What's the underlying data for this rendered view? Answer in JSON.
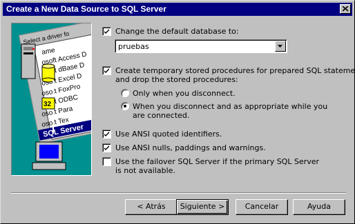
{
  "window": {
    "title": "Create a New Data Source to SQL Server"
  },
  "illustration": {
    "panel_heading": "Select a driver fo",
    "driver_items": [
      "ame",
      "osoft Access D",
      "osoft dBase D",
      "osoft Excel D",
      "osoft FoxPro",
      "osoft ODBC",
      "osoft Para",
      "osoft Tex",
      "SQL Server"
    ],
    "badge": "32"
  },
  "options": {
    "change_default_db": {
      "label": "Change the default database to:",
      "checked": true
    },
    "database": {
      "value": "pruebas"
    },
    "create_temp_sp": {
      "label_line1": "Create temporary stored procedures for prepared SQL statements",
      "label_line2": "and drop the stored procedures:",
      "checked": true
    },
    "radio_only_disconnect": {
      "label": "Only when you disconnect.",
      "selected": false
    },
    "radio_when_disconnect": {
      "label_line1": "When you disconnect and as appropriate while you",
      "label_line2": "are connected.",
      "selected": true
    },
    "ansi_quoted": {
      "label": "Use ANSI quoted identifiers.",
      "checked": true
    },
    "ansi_nulls": {
      "label": "Use ANSI nulls, paddings and warnings.",
      "checked": true
    },
    "failover": {
      "label_line1": "Use the failover SQL Server if the primary SQL Server",
      "label_line2": "is not available.",
      "checked": false
    }
  },
  "buttons": {
    "back": "< Atrás",
    "next": "Siguiente >",
    "cancel": "Cancelar",
    "help": "Ayuda"
  }
}
